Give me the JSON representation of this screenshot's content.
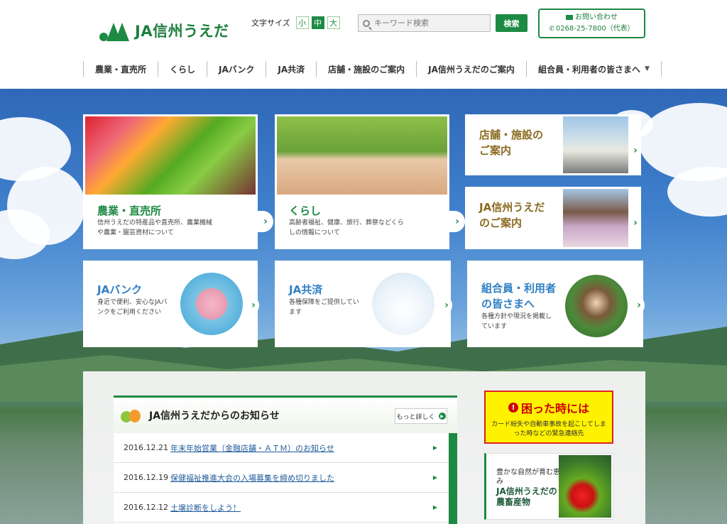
{
  "header": {
    "logo_text": "JA信州うえだ",
    "font_size_label": "文字サイズ",
    "font_sizes": [
      "小",
      "中",
      "大"
    ],
    "search_placeholder": "キーワード検索",
    "search_button": "検索",
    "contact_label": "お問い合わせ",
    "contact_phone": "0268-25-7800（代表）"
  },
  "nav": {
    "items": [
      "農業・直売所",
      "くらし",
      "JAバンク",
      "JA共済",
      "店舗・施設のご案内",
      "JA信州うえだのご案内",
      "組合員・利用者の皆さまへ"
    ]
  },
  "cards": {
    "nogyo": {
      "title": "農業・直売所",
      "desc1": "信州うえだの特産品や直売所、農業機械",
      "desc2": "や農業・園芸資材について"
    },
    "kurashi": {
      "title": "くらし",
      "desc1": "高齢者福祉、健康、旅行、葬祭などくら",
      "desc2": "しの情報について"
    },
    "tenpo": {
      "title1": "店舗・施設の",
      "title2": "ご案内"
    },
    "annai": {
      "title1": "JA信州うえだ",
      "title2": "のご案内"
    },
    "bank": {
      "title": "JAバンク",
      "desc1": "身近で便利、安心なJAバ",
      "desc2": "ンクをご利用ください"
    },
    "kyosai": {
      "title": "JA共済",
      "desc1": "各種保障をご提供してい",
      "desc2": "ます"
    },
    "kumiai": {
      "title1": "組合員・利用者",
      "title2": "の皆さまへ",
      "desc1": "各種方針や現況を掲載し",
      "desc2": "ています"
    }
  },
  "news": {
    "title": "JA信州うえだからのお知らせ",
    "more": "もっと詳しく",
    "items": [
      {
        "date": "2016.12.21",
        "text": "年末年始営業（金融店舗・ＡＴＭ）のお知らせ"
      },
      {
        "date": "2016.12.19",
        "text": "保健福祉推進大会の入場募集を締め切りました"
      },
      {
        "date": "2016.12.12",
        "text": "土壌診断をしよう！"
      }
    ]
  },
  "trouble": {
    "title": "困った時には",
    "desc": "カード紛失や自動車事故を起こしてしまった時などの緊急連絡先"
  },
  "products": {
    "small": "豊かな自然が育む恵み",
    "big": "JA信州うえだの農畜産物"
  }
}
